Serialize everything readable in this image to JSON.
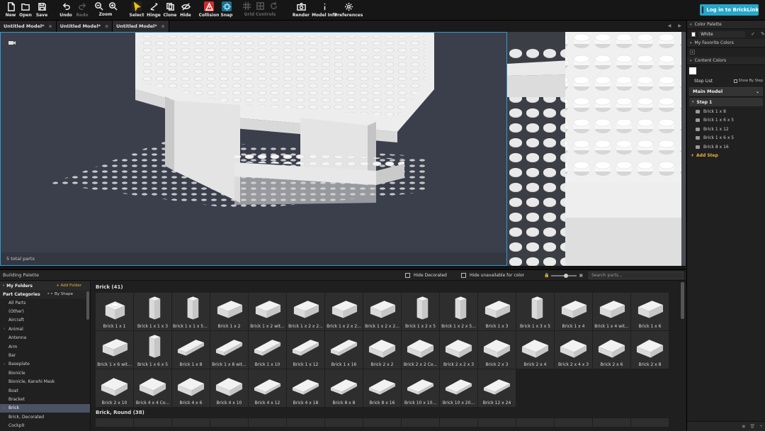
{
  "toolbar": {
    "items": [
      {
        "label": "New",
        "icon": "new-file-icon"
      },
      {
        "label": "Open",
        "icon": "folder-open-icon"
      },
      {
        "label": "Save",
        "icon": "save-icon"
      },
      {
        "label": "Undo",
        "icon": "undo-icon"
      },
      {
        "label": "Redo",
        "icon": "redo-icon"
      },
      {
        "label": "Zoom",
        "icon": "zoom-icon"
      },
      {
        "label": "Select",
        "icon": "select-cursor-icon"
      },
      {
        "label": "Hinge",
        "icon": "hinge-icon"
      },
      {
        "label": "Clone",
        "icon": "clone-icon"
      },
      {
        "label": "Hide",
        "icon": "hide-eye-icon"
      },
      {
        "label": "Collision",
        "icon": "collision-warning-icon"
      },
      {
        "label": "Snap",
        "icon": "snap-icon"
      },
      {
        "label": "Grid Controls",
        "icon": "grid-icon"
      },
      {
        "label": "Render",
        "icon": "camera-icon"
      },
      {
        "label": "Model Info",
        "icon": "info-icon"
      },
      {
        "label": "Preferences",
        "icon": "gear-icon"
      }
    ],
    "login_label": "Log in to BrickLink"
  },
  "tabs": [
    {
      "title": "Untitled Model*",
      "active": false
    },
    {
      "title": "Untitled Model*",
      "active": false
    },
    {
      "title": "Untitled Model*",
      "active": true
    }
  ],
  "viewport": {
    "parts_count": "5 total parts"
  },
  "right_panel": {
    "color_palette_title": "Color Palette",
    "selected_color": "White",
    "favorite_colors_title": "My Favorite Colors",
    "content_colors_title": "Content Colors",
    "step_list_title": "Step List",
    "show_by_step": "Show By Step",
    "main_model": "Main Model",
    "step_title": "Step 1",
    "step_items": [
      "Brick 1 x 8",
      "Brick 1 x 6 x 5",
      "Brick 1 x 12",
      "Brick 1 x 6 x 5",
      "Brick 8 x 16"
    ],
    "add_step": "Add Step"
  },
  "building_palette": {
    "title": "Building Palette",
    "hide_decorated": "Hide Decorated",
    "hide_unavailable": "Hide unavailable for color",
    "search_placeholder": "Search parts...",
    "my_folders": "My Folders",
    "add_folder": "Add Folder",
    "part_categories": "Part Categories",
    "by_shape": "By Shape",
    "categories": [
      "All Parts",
      "(Other)",
      "Aircraft",
      "Animal",
      "Antenna",
      "Arm",
      "Bar",
      "Baseplate",
      "Bionicle",
      "Bionicle, Kanohi Mask",
      "Boat",
      "Bracket",
      "Brick",
      "Brick, Decorated",
      "Cockpit"
    ],
    "selected_category": "Brick",
    "section_bricks": "Brick (41)",
    "section_round": "Brick, Round (38)",
    "bricks": [
      "Brick 1 x 1",
      "Brick 1 x 1 x 3",
      "Brick 1 x 1 x 5 -...",
      "Brick 1 x 2",
      "Brick 1 x 2 wit...",
      "Brick 1 x 2 x 2...",
      "Brick 1 x 2 x 2...",
      "Brick 1 x 2 x 2...",
      "Brick 1 x 2 x 5",
      "Brick 1 x 2 x 5...",
      "Brick 1 x 3",
      "Brick 1 x 3 x 5",
      "Brick 1 x 4",
      "Brick 1 x 4 wit...",
      "Brick 1 x 6",
      "Brick 1 x 6 wit...",
      "Brick 1 x 6 x 5",
      "Brick 1 x 8",
      "Brick 1 x 8 wit...",
      "Brick 1 x 10",
      "Brick 1 x 12",
      "Brick 1 x 16",
      "Brick 2 x 2",
      "Brick 2 x 2 Co...",
      "Brick 2 x 2 x 3",
      "Brick 2 x 3",
      "Brick 2 x 4",
      "Brick 2 x 4 x 3",
      "Brick 2 x 6",
      "Brick 2 x 8",
      "Brick 2 x 10",
      "Brick 4 x 4 Co...",
      "Brick 4 x 6",
      "Brick 4 x 10",
      "Brick 4 x 12",
      "Brick 4 x 18",
      "Brick 8 x 8",
      "Brick 8 x 16",
      "Brick 10 x 10...",
      "Brick 10 x 20...",
      "Brick 12 x 24"
    ]
  }
}
